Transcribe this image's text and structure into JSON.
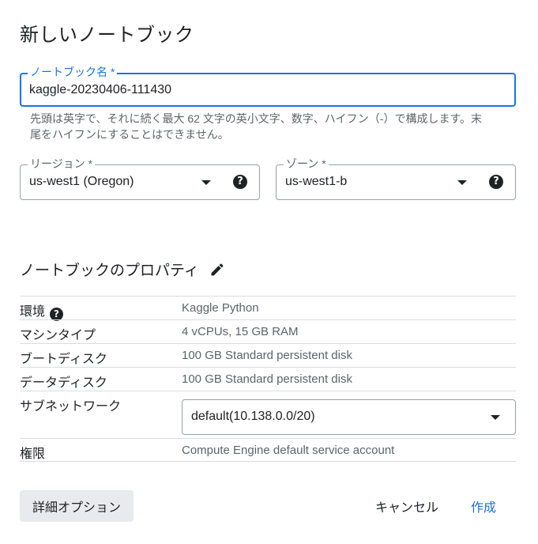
{
  "dialog": {
    "title": "新しいノートブック"
  },
  "notebook_name": {
    "label": "ノートブック名 *",
    "value": "kaggle-20230406-111430",
    "hint": "先頭は英字で、それに続く最大 62 文字の英小文字、数字、ハイフン（-）で構成します。末尾をハイフンにすることはできません。"
  },
  "region": {
    "label": "リージョン *",
    "value": "us-west1 (Oregon)"
  },
  "zone": {
    "label": "ゾーン *",
    "value": "us-west1-b"
  },
  "properties": {
    "title": "ノートブックのプロパティ",
    "rows": [
      {
        "key": "環境",
        "value": "Kaggle Python"
      },
      {
        "key": "マシンタイプ",
        "value": "4 vCPUs, 15 GB RAM"
      },
      {
        "key": "ブートディスク",
        "value": "100 GB Standard persistent disk"
      },
      {
        "key": "データディスク",
        "value": "100 GB Standard persistent disk"
      },
      {
        "key": "サブネットワーク",
        "value": "default(10.138.0.0/20)"
      },
      {
        "key": "権限",
        "value": "Compute Engine default service account"
      }
    ]
  },
  "buttons": {
    "advanced": "詳細オプション",
    "cancel": "キャンセル",
    "create": "作成"
  },
  "icons": {
    "help": "help-circle-icon",
    "dropdown": "caret-down-icon",
    "edit": "pencil-icon"
  },
  "colors": {
    "accent": "#1a73e8",
    "text": "#202124",
    "secondary_text": "#5f6368",
    "divider": "#dadce0",
    "secondary_button_bg": "#e8eaed"
  }
}
